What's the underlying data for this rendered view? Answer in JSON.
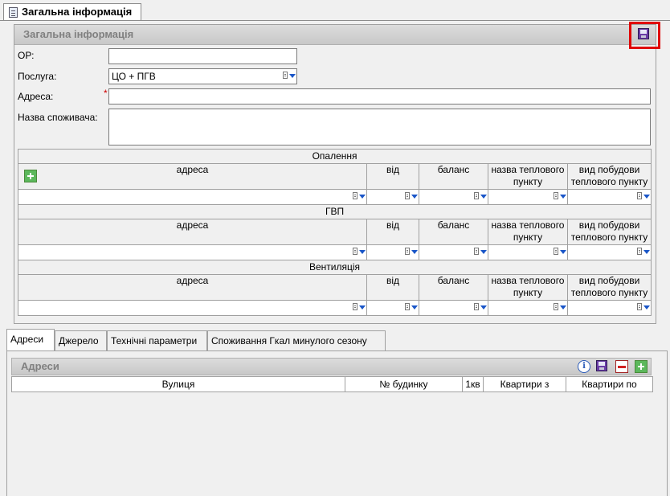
{
  "top_tab": {
    "label": "Загальна інформація"
  },
  "panel": {
    "title": "Загальна інформація"
  },
  "fields": {
    "or_label": "ОР:",
    "or_value": "",
    "service_label": "Послуга:",
    "service_value": "ЦО + ПГВ",
    "address_label": "Адреса:",
    "address_required_mark": "*",
    "address_value": "",
    "consumer_label": "Назва споживача:",
    "consumer_value": ""
  },
  "sections": [
    {
      "title": "Опалення"
    },
    {
      "title": "ГВП"
    },
    {
      "title": "Вентиляція"
    }
  ],
  "columns": {
    "address": "адреса",
    "from": "від",
    "balance": "баланс",
    "heat_point_name": "назва теплового пункту",
    "heat_point_type": "вид побудови теплового пункту"
  },
  "lower_tabs": [
    {
      "label": "Адреси",
      "active": true
    },
    {
      "label": "Джерело",
      "active": false
    },
    {
      "label": "Технічні параметри",
      "active": false
    },
    {
      "label": "Споживання Гкал минулого сезону",
      "active": false
    }
  ],
  "addresses": {
    "title": "Адреси",
    "columns": [
      "Вулиця",
      "№ будинку",
      "1кв",
      "Квартири з",
      "Квартири по"
    ],
    "rows": []
  },
  "icons": {
    "save": "floppy-disk-icon",
    "add": "plus-icon",
    "remove": "minus-icon",
    "info": "info-icon",
    "dropdown": "list-dropdown-icon"
  },
  "colors": {
    "highlight_frame": "#e00000",
    "panel_header_text": "#808080",
    "add_green": "#5cb85c",
    "remove_red": "#d02020"
  }
}
